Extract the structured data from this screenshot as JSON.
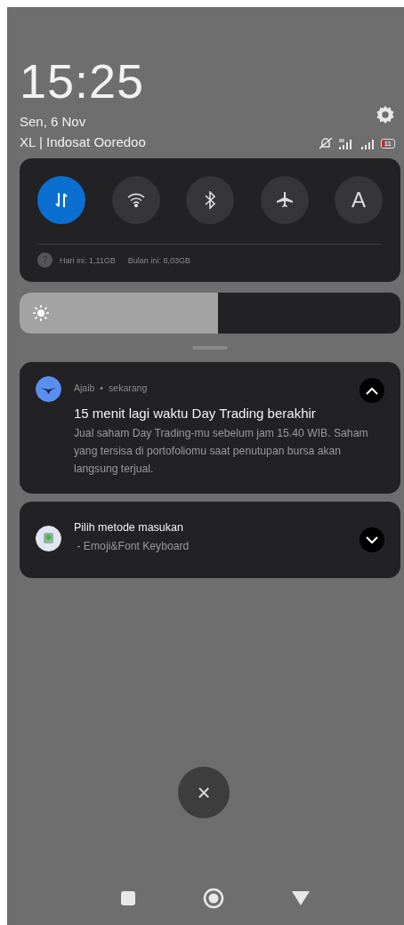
{
  "header": {
    "time": "15:25",
    "date": "Sen, 6 Nov",
    "carrier": "XL | Indosat Ooredoo",
    "battery": "11"
  },
  "toggles": [
    {
      "kind": "data",
      "on": true
    },
    {
      "kind": "wifi",
      "on": false
    },
    {
      "kind": "bluetooth",
      "on": false
    },
    {
      "kind": "airplane",
      "on": false
    },
    {
      "kind": "text",
      "label": "A",
      "on": false
    }
  ],
  "data_usage": {
    "help": "?",
    "today": "Hari ini: 1,11GB",
    "month": "Bulan ini: 8,03GB"
  },
  "brightness": {
    "level": 0.52
  },
  "notifications": [
    {
      "kind": "expanded",
      "app": "Ajaib",
      "separator": "•",
      "time": "sekarang",
      "title": "15 menit lagi waktu Day Trading berakhir",
      "body": "Jual saham Day Trading-mu sebelum jam 15.40 WIB. Saham yang tersisa di portofoliomu saat penutupan bursa akan langsung terjual.",
      "expanded": true
    },
    {
      "kind": "simple",
      "title": "Pilih metode masukan",
      "body": " - Emoji&Font Keyboard",
      "expanded": false
    }
  ],
  "clear_button": {
    "label": "×"
  }
}
